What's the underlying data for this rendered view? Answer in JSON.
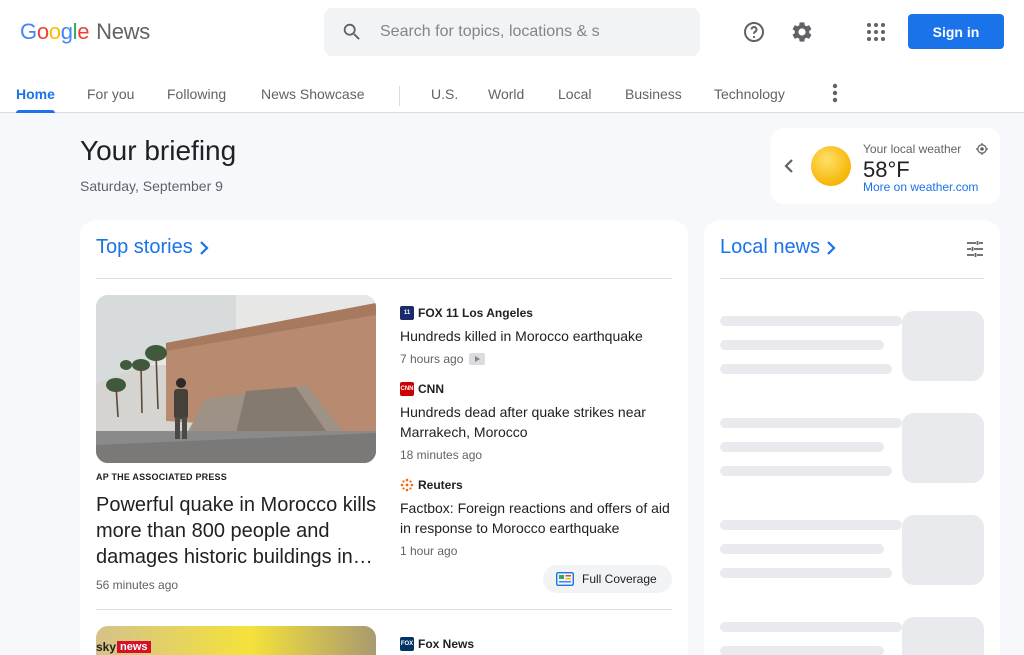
{
  "brand": {
    "google": [
      "G",
      "o",
      "o",
      "g",
      "l",
      "e"
    ],
    "product": "News"
  },
  "search": {
    "placeholder": "Search for topics, locations & s"
  },
  "header": {
    "signin_label": "Sign in"
  },
  "nav": {
    "tabs": [
      "Home",
      "For you",
      "Following",
      "News Showcase",
      "U.S.",
      "World",
      "Local",
      "Business",
      "Technology"
    ],
    "active": "Home"
  },
  "briefing": {
    "title": "Your briefing",
    "date": "Saturday, September 9"
  },
  "weather": {
    "label": "Your local weather",
    "temp": "58°F",
    "link": "More on weather.com"
  },
  "top_stories": {
    "title": "Top stories",
    "main": {
      "source": "AP THE ASSOCIATED PRESS",
      "headline": "Powerful quake in Morocco kills more than 800 people and damages historic buildings in…",
      "time": "56 minutes ago"
    },
    "related": [
      {
        "source": "FOX 11 Los Angeles",
        "headline": "Hundreds killed in Morocco earthquake",
        "time": "7 hours ago",
        "has_video": true
      },
      {
        "source": "CNN",
        "headline": "Hundreds dead after quake strikes near Marrakech, Morocco",
        "time": "18 minutes ago",
        "has_video": false
      },
      {
        "source": "Reuters",
        "headline": "Factbox: Foreign reactions and offers of aid in response to Morocco earthquake",
        "time": "1 hour ago",
        "has_video": false
      }
    ],
    "full_coverage": "Full Coverage",
    "second": {
      "image_brand": [
        "sky",
        "news"
      ],
      "source": "Fox News"
    }
  },
  "local_news": {
    "title": "Local news"
  },
  "colors": {
    "accent": "#1a73e8",
    "text": "#202124",
    "muted": "#5f6368",
    "bg": "#f6f8fc"
  }
}
